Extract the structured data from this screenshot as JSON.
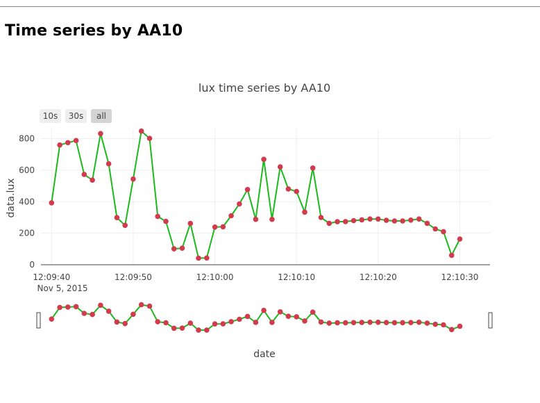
{
  "page": {
    "title": "Time series by AA10"
  },
  "range_selector": {
    "buttons": [
      {
        "label": "10s",
        "active": false
      },
      {
        "label": "30s",
        "active": false
      },
      {
        "label": "all",
        "active": true
      }
    ]
  },
  "range_slider": {
    "visible": true
  },
  "colors": {
    "line": "#1aba1a",
    "marker": "#d23a4e",
    "grid": "#eeeeee",
    "axis": "#444444"
  },
  "chart_data": {
    "type": "line",
    "title": "lux time series by AA10",
    "xlabel": "date",
    "ylabel": "data.lux",
    "grid": true,
    "x_start": "2015-11-05 12:09:40",
    "x_step_seconds": 1,
    "xlim": [
      "2015-11-05 12:09:38.7",
      "2015-11-05 12:10:33.7"
    ],
    "ylim": [
      0,
      860
    ],
    "x_ticks": [
      "12:09:40",
      "12:09:50",
      "12:10:00",
      "12:10:10",
      "12:10:20",
      "12:10:30"
    ],
    "x_tick_date": "Nov 5, 2015",
    "y_ticks": [
      0,
      200,
      400,
      600,
      800
    ],
    "series": [
      {
        "values": [
          393,
          760,
          775,
          788,
          573,
          537,
          832,
          641,
          299,
          250,
          544,
          848,
          802,
          307,
          275,
          101,
          105,
          262,
          42,
          43,
          239,
          241,
          311,
          386,
          477,
          288,
          669,
          288,
          621,
          481,
          465,
          334,
          614,
          300,
          263,
          273,
          274,
          280,
          285,
          290,
          290,
          282,
          278,
          278,
          283,
          290,
          263,
          227,
          210,
          60,
          163
        ]
      }
    ]
  }
}
